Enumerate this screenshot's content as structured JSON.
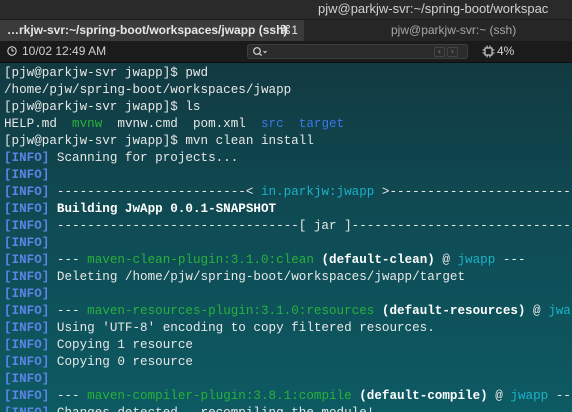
{
  "window": {
    "title": "pjw@parkjw-svr:~/spring-boot/workspac"
  },
  "tabs": [
    {
      "label": "…rkjw-svr:~/spring-boot/workspaces/jwapp (ssh)",
      "shortcut": "⌘1",
      "active": true
    },
    {
      "label": "pjw@parkjw-svr:~ (ssh)",
      "active": false
    }
  ],
  "statusbar": {
    "clock": "10/02 12:49 AM",
    "search_placeholder": "",
    "cpu": "4%",
    "icons": [
      "clock-icon",
      "search-icon",
      "cpu-icon"
    ]
  },
  "colors": {
    "info": "#5a84e6",
    "green": "#29b13a",
    "blue": "#3a78e8",
    "cyan": "#1ab3c9"
  },
  "terminal": {
    "lines": [
      [
        {
          "t": "[pjw@parkjw-svr jwapp]$ pwd",
          "c": "default"
        }
      ],
      [
        {
          "t": "/home/pjw/spring-boot/workspaces/jwapp",
          "c": "default"
        }
      ],
      [
        {
          "t": "[pjw@parkjw-svr jwapp]$ ls",
          "c": "default"
        }
      ],
      [
        {
          "t": "HELP.md  ",
          "c": "default"
        },
        {
          "t": "mvnw",
          "c": "green"
        },
        {
          "t": "  mvnw.cmd  pom.xml  ",
          "c": "default"
        },
        {
          "t": "src",
          "c": "blue"
        },
        {
          "t": "  ",
          "c": "default"
        },
        {
          "t": "target",
          "c": "blue"
        }
      ],
      [
        {
          "t": "[pjw@parkjw-svr jwapp]$ mvn clean install",
          "c": "default"
        }
      ],
      [
        {
          "t": "[INFO]",
          "c": "info"
        },
        {
          "t": " Scanning for projects...",
          "c": "default"
        }
      ],
      [
        {
          "t": "[INFO]",
          "c": "info"
        }
      ],
      [
        {
          "t": "[INFO]",
          "c": "info"
        },
        {
          "t": " -------------------------< ",
          "c": "default"
        },
        {
          "t": "in.parkjw:jwapp",
          "c": "cyan"
        },
        {
          "t": " >--------------------------",
          "c": "default"
        }
      ],
      [
        {
          "t": "[INFO]",
          "c": "info"
        },
        {
          "t": " Building JwApp 0.0.1-SNAPSHOT",
          "c": "bold"
        }
      ],
      [
        {
          "t": "[INFO]",
          "c": "info"
        },
        {
          "t": " --------------------------------[ jar ]---------------------------------",
          "c": "default"
        }
      ],
      [
        {
          "t": "[INFO]",
          "c": "info"
        }
      ],
      [
        {
          "t": "[INFO]",
          "c": "info"
        },
        {
          "t": " --- ",
          "c": "default"
        },
        {
          "t": "maven-clean-plugin:3.1.0:clean",
          "c": "green"
        },
        {
          "t": " (default-clean)",
          "c": "bold"
        },
        {
          "t": " @ ",
          "c": "default"
        },
        {
          "t": "jwapp",
          "c": "cyan"
        },
        {
          "t": " ---",
          "c": "default"
        }
      ],
      [
        {
          "t": "[INFO]",
          "c": "info"
        },
        {
          "t": " Deleting /home/pjw/spring-boot/workspaces/jwapp/target",
          "c": "default"
        }
      ],
      [
        {
          "t": "[INFO]",
          "c": "info"
        }
      ],
      [
        {
          "t": "[INFO]",
          "c": "info"
        },
        {
          "t": " --- ",
          "c": "default"
        },
        {
          "t": "maven-resources-plugin:3.1.0:resources",
          "c": "green"
        },
        {
          "t": " (default-resources)",
          "c": "bold"
        },
        {
          "t": " @ ",
          "c": "default"
        },
        {
          "t": "jwapp",
          "c": "cyan"
        },
        {
          "t": " ---",
          "c": "default"
        }
      ],
      [
        {
          "t": "[INFO]",
          "c": "info"
        },
        {
          "t": " Using 'UTF-8' encoding to copy filtered resources.",
          "c": "default"
        }
      ],
      [
        {
          "t": "[INFO]",
          "c": "info"
        },
        {
          "t": " Copying 1 resource",
          "c": "default"
        }
      ],
      [
        {
          "t": "[INFO]",
          "c": "info"
        },
        {
          "t": " Copying 0 resource",
          "c": "default"
        }
      ],
      [
        {
          "t": "[INFO]",
          "c": "info"
        }
      ],
      [
        {
          "t": "[INFO]",
          "c": "info"
        },
        {
          "t": " --- ",
          "c": "default"
        },
        {
          "t": "maven-compiler-plugin:3.8.1:compile",
          "c": "green"
        },
        {
          "t": " (default-compile)",
          "c": "bold"
        },
        {
          "t": " @ ",
          "c": "default"
        },
        {
          "t": "jwapp",
          "c": "cyan"
        },
        {
          "t": " ---",
          "c": "default"
        }
      ],
      [
        {
          "t": "[INFO]",
          "c": "info"
        },
        {
          "t": " Changes detected - recompiling the module!",
          "c": "default"
        }
      ]
    ]
  }
}
